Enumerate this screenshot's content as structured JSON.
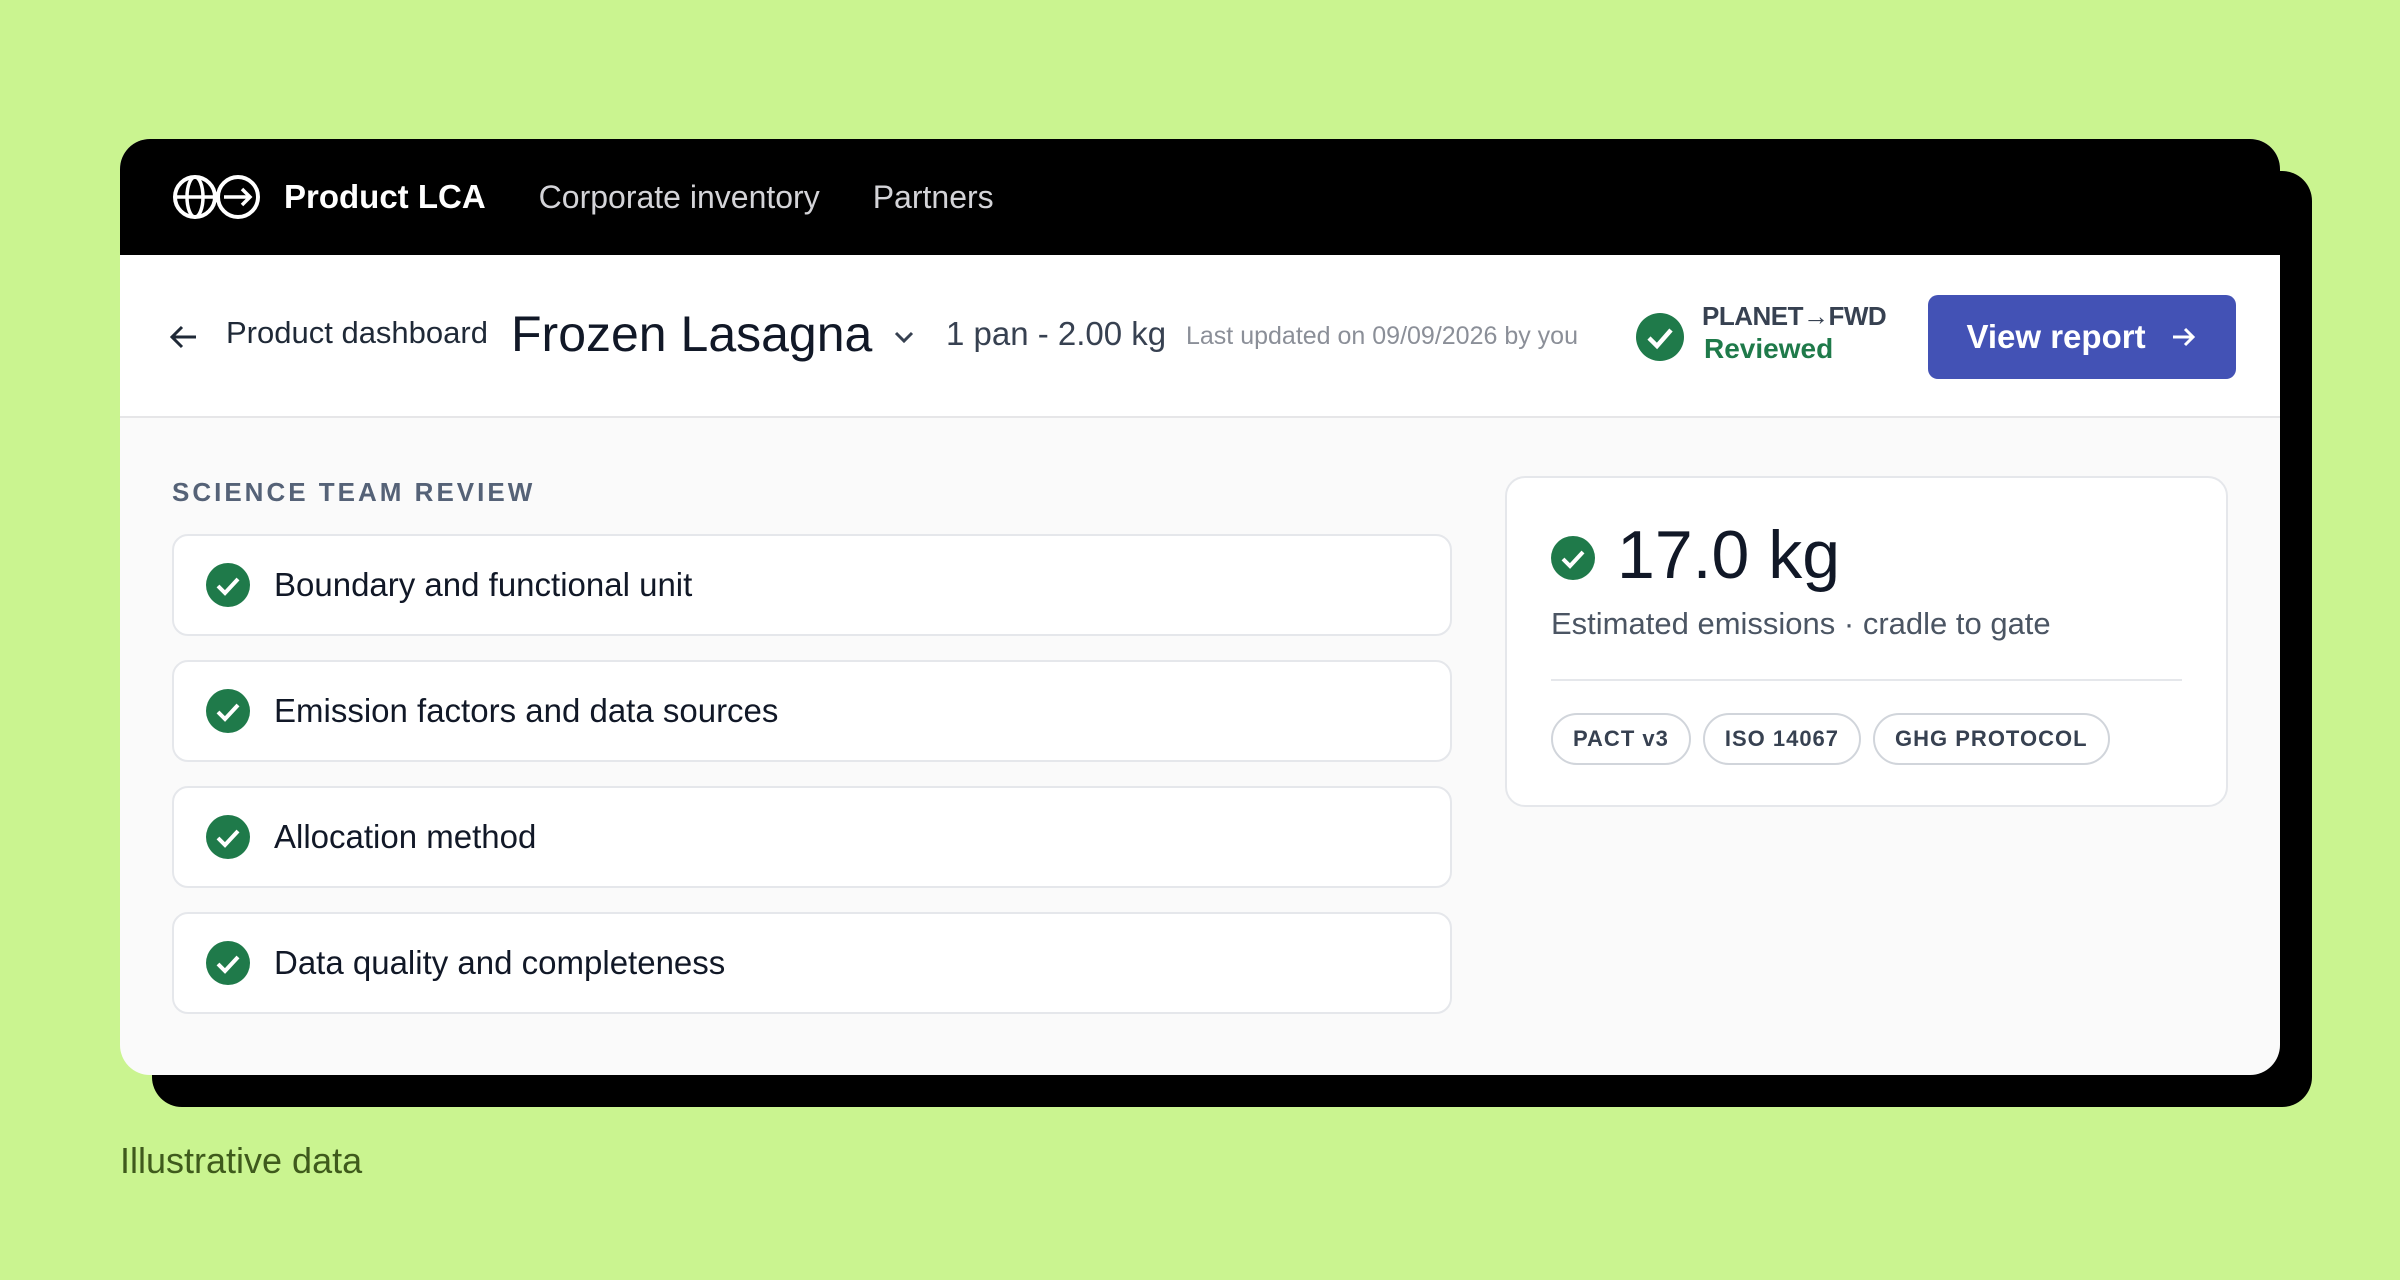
{
  "nav": {
    "brand": "Product LCA",
    "links": [
      "Corporate inventory",
      "Partners"
    ]
  },
  "header": {
    "breadcrumb": "Product dashboard",
    "product_name": "Frozen Lasagna",
    "portion": "1 pan - 2.00 kg",
    "last_updated": "Last updated on 09/09/2026 by you",
    "partner_logo": "PLANET→FWD",
    "review_status": "Reviewed",
    "view_report_label": "View report"
  },
  "review": {
    "title": "SCIENCE TEAM REVIEW",
    "items": [
      "Boundary and functional unit",
      "Emission factors and data sources",
      "Allocation method",
      "Data quality and completeness"
    ]
  },
  "emissions": {
    "value": "17.0 kg",
    "subtitle": "Estimated emissions · cradle to gate",
    "tags": [
      "PACT v3",
      "ISO 14067",
      "GHG PROTOCOL"
    ]
  },
  "caption": "Illustrative data",
  "colors": {
    "background": "#caf490",
    "accent": "#4352b5",
    "success": "#1f7a4a"
  }
}
